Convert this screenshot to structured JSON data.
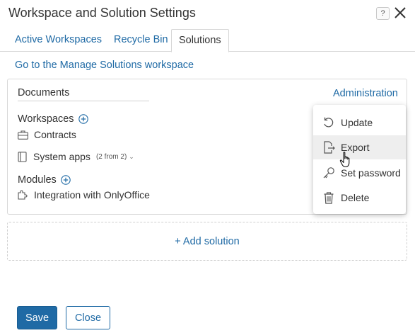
{
  "dialog": {
    "title": "Workspace and Solution Settings",
    "help_label": "?"
  },
  "tabs": [
    {
      "label": "Active Workspaces"
    },
    {
      "label": "Recycle Bin"
    },
    {
      "label": "Solutions"
    }
  ],
  "manage_link": "Go to the Manage Solutions workspace",
  "solution": {
    "name": "Documents",
    "admin_label": "Administration",
    "workspaces_label": "Workspaces",
    "workspaces": [
      {
        "label": "Contracts",
        "icon": "briefcase-icon"
      },
      {
        "label": "System apps",
        "icon": "book-icon",
        "count": "(2 from 2)",
        "chevron": "⌄"
      }
    ],
    "modules_label": "Modules",
    "modules": [
      {
        "label": "Integration with OnlyOffice",
        "icon": "puzzle-icon"
      }
    ]
  },
  "admin_menu": {
    "items": [
      {
        "label": "Update",
        "icon": "undo-icon"
      },
      {
        "label": "Export",
        "icon": "export-icon"
      },
      {
        "label": "Set password",
        "icon": "key-icon"
      },
      {
        "label": "Delete",
        "icon": "trash-icon"
      }
    ]
  },
  "add_solution": "+ Add solution",
  "footer": {
    "save_label": "Save",
    "close_label": "Close"
  },
  "colors": {
    "accent": "#1f6aa5",
    "text": "#333333",
    "border": "#d9d9d9"
  }
}
